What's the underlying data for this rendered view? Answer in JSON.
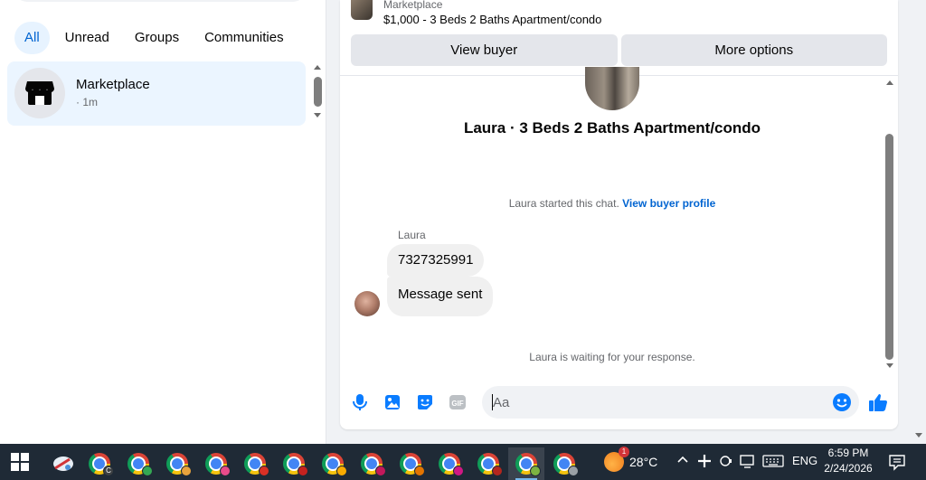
{
  "left": {
    "filters": [
      "All",
      "Unread",
      "Groups",
      "Communities"
    ],
    "active_filter": "All",
    "conversation": {
      "title": "Marketplace",
      "time": "· 1m",
      "icon": "marketplace-store-icon"
    }
  },
  "chat": {
    "item_source": "Marketplace",
    "item_title": "$1,000 - 3 Beds 2 Baths Apartment/condo",
    "view_buyer_label": "View buyer",
    "more_options_label": "More options",
    "listing_title": "Laura · 3 Beds 2 Baths Apartment/condo",
    "started_text": "Laura started this chat.",
    "view_buyer_profile_label": "View buyer profile",
    "sender_name": "Laura",
    "messages": [
      "7327325991",
      "Message sent"
    ],
    "waiting_text": "Laura is waiting for your response.",
    "composer": {
      "placeholder": "Aa",
      "icons": [
        "microphone-icon",
        "image-icon",
        "sticker-icon",
        "gif-icon",
        "emoji-icon",
        "thumbs-up-icon"
      ],
      "gif_label": "GIF"
    },
    "accent_color": "#0a7cff"
  },
  "taskbar": {
    "weather_temp": "28°C",
    "weather_badge": "1",
    "language": "ENG",
    "time": "6:59 PM",
    "date": "2/24/2026",
    "profile_badges": [
      "C",
      "",
      "",
      "",
      "",
      "",
      "",
      "",
      "",
      "",
      "",
      "",
      ""
    ]
  }
}
